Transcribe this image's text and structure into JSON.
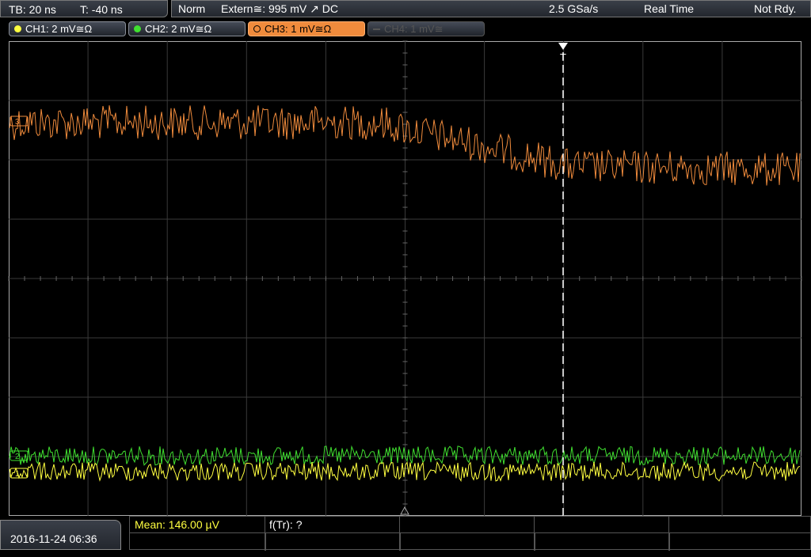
{
  "header": {
    "timebase": "TB: 20 ns",
    "trigger_time": "T: -40 ns",
    "trigger_mode": "Norm",
    "trigger_source": "Extern≅: 995 mV ↗ DC",
    "sample_rate": "2.5 GSa/s",
    "acq_mode": "Real Time",
    "status": "Not Rdy."
  },
  "channels": [
    {
      "label": "CH1: 2 mV≅Ω",
      "color": "#ffff40",
      "state": "on"
    },
    {
      "label": "CH2: 2 mV≅Ω",
      "color": "#40e030",
      "state": "on"
    },
    {
      "label": "CH3: 1 mV≅Ω",
      "color": "#f08b3c",
      "state": "active"
    },
    {
      "label": "CH4: 1 mV≅",
      "color": "#555555",
      "state": "off"
    }
  ],
  "markers": {
    "trigger": "T",
    "ch3": "3",
    "ch2": "2",
    "ch1": "1"
  },
  "footer": {
    "datetime": "2016-11-24 06:36",
    "mean": "Mean: 146.00 µV",
    "ftr": "f(Tr): ?"
  }
}
